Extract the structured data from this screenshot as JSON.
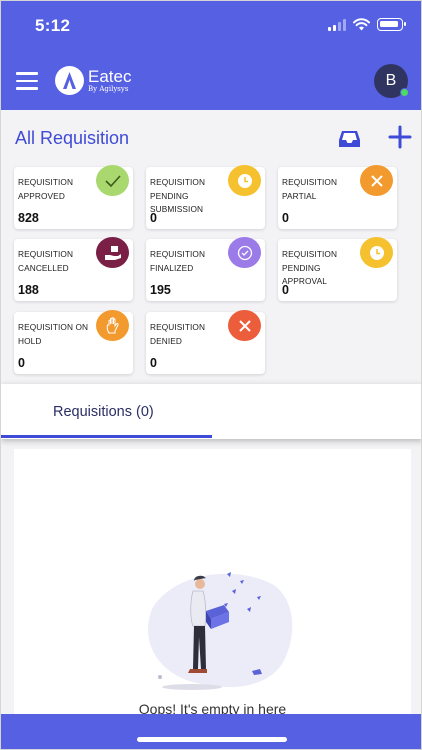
{
  "status_bar": {
    "time": "5:12"
  },
  "header": {
    "brand_name": "Eatec",
    "brand_tagline": "By Agilysys",
    "avatar_initial": "B"
  },
  "page": {
    "title": "All Requisition"
  },
  "cards": [
    {
      "label": "REQUISITION APPROVED",
      "count": "828",
      "icon": "check-icon",
      "color": "#a8d86e"
    },
    {
      "label": "REQUISITION PENDING SUBMISSION",
      "count": "0",
      "icon": "clock-icon",
      "color": "#f5c12e"
    },
    {
      "label": "REQUISITION PARTIAL",
      "count": "0",
      "icon": "close-icon",
      "color": "#f39a2f"
    },
    {
      "label": "REQUISITION CANCELLED",
      "count": "188",
      "icon": "hand-box-icon",
      "color": "#7a1f45"
    },
    {
      "label": "REQUISITION FINALIZED",
      "count": "195",
      "icon": "check-circle-icon",
      "color": "#9b7be8"
    },
    {
      "label": "REQUISITION PENDING APPROVAL",
      "count": "0",
      "icon": "clock-icon",
      "color": "#f5c12e"
    },
    {
      "label": "REQUISITION ON HOLD",
      "count": "0",
      "icon": "hand-icon",
      "color": "#f39a2f"
    },
    {
      "label": "REQUISITION DENIED",
      "count": "0",
      "icon": "close-icon",
      "color": "#ec5d3c"
    }
  ],
  "tabs": [
    {
      "label": "Requisitions (0)"
    }
  ],
  "empty_state": {
    "message": "Oops! It's empty in here"
  },
  "colors": {
    "primary": "#5660e3",
    "accent": "#3f4bd6"
  }
}
